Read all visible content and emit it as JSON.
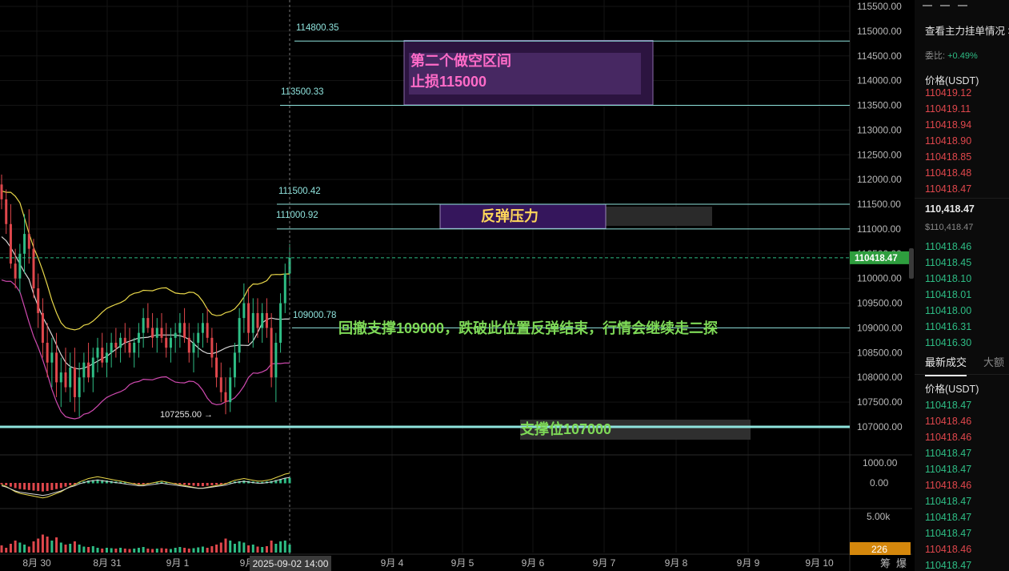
{
  "chart_data": {
    "type": "candlestick",
    "symbol_price_label": "110418.47",
    "current_price": 110418.47,
    "y_axis_ticks": [
      "115500.00",
      "115000.00",
      "114500.00",
      "114000.00",
      "113500.00",
      "113000.00",
      "112500.00",
      "112000.00",
      "111500.00",
      "111000.00",
      "110500.00",
      "110000.00",
      "109500.00",
      "109000.00",
      "108500.00",
      "108000.00",
      "107500.00",
      "107000.00"
    ],
    "y_axis_values": [
      115500,
      115000,
      114500,
      114000,
      113500,
      113000,
      112500,
      112000,
      111500,
      111000,
      110500,
      110000,
      109500,
      109000,
      108500,
      108000,
      107500,
      107000
    ],
    "ylim": [
      106700,
      115700
    ],
    "x_axis_ticks": [
      "8月 30",
      "8月 31",
      "9月 1",
      "9月",
      "9月 4",
      "9月 5",
      "9月 6",
      "9月 7",
      "9月 8",
      "9月 9",
      "9月 10"
    ],
    "crosshair_time": "2025-09-02 14:00",
    "price_lines": [
      {
        "label": "114800.35",
        "value": 114800.35
      },
      {
        "label": "113500.33",
        "value": 113500.33
      },
      {
        "label": "111500.42",
        "value": 111500.42
      },
      {
        "label": "111000.92",
        "value": 111000.92
      },
      {
        "label": "109000.78",
        "value": 109000.78
      },
      {
        "label": "",
        "value": 107000
      }
    ],
    "low_marker": {
      "label": "107255.00",
      "value": 107255
    },
    "zones": [
      {
        "name": "short_zone",
        "line1": "第二个做空区间",
        "line2": "止损115000",
        "top": 114780,
        "bottom": 113510,
        "color": "#5a2a78"
      },
      {
        "name": "rebound_pressure",
        "text": "反弹压力",
        "top": 111500,
        "bottom": 111010,
        "color": "#3a1760"
      },
      {
        "name": "support",
        "text": "支撑位107000",
        "top": 107140,
        "bottom": 106720,
        "color": "#333333"
      }
    ],
    "annotation": "回撤支撑109000，跌破此位置反弹结束，行情会继续走二探",
    "macd_axis_ticks": [
      "1000.00",
      "0.00"
    ],
    "volume_axis_ticks": [
      "5.00k"
    ],
    "volume_badge": "226",
    "bottom_right_labels": [
      "筹",
      "爆"
    ],
    "candles": [
      {
        "o": 111900,
        "h": 112100,
        "l": 111400,
        "c": 111600
      },
      {
        "o": 111600,
        "h": 111800,
        "l": 110900,
        "c": 111100
      },
      {
        "o": 111100,
        "h": 111500,
        "l": 110200,
        "c": 110300
      },
      {
        "o": 110300,
        "h": 110600,
        "l": 109800,
        "c": 110000
      },
      {
        "o": 110000,
        "h": 110700,
        "l": 109700,
        "c": 110500
      },
      {
        "o": 110500,
        "h": 111300,
        "l": 110100,
        "c": 110900
      },
      {
        "o": 110900,
        "h": 111400,
        "l": 110300,
        "c": 110600
      },
      {
        "o": 110600,
        "h": 110800,
        "l": 109600,
        "c": 109800
      },
      {
        "o": 109800,
        "h": 110100,
        "l": 109000,
        "c": 109300
      },
      {
        "o": 109300,
        "h": 109600,
        "l": 108400,
        "c": 108700
      },
      {
        "o": 108700,
        "h": 109100,
        "l": 108000,
        "c": 108300
      },
      {
        "o": 108300,
        "h": 108800,
        "l": 107800,
        "c": 108500
      },
      {
        "o": 108500,
        "h": 108900,
        "l": 107600,
        "c": 107900
      },
      {
        "o": 107900,
        "h": 108400,
        "l": 107400,
        "c": 108100
      },
      {
        "o": 108100,
        "h": 108600,
        "l": 107700,
        "c": 107800
      },
      {
        "o": 107800,
        "h": 108500,
        "l": 107500,
        "c": 108200
      },
      {
        "o": 108200,
        "h": 108600,
        "l": 107300,
        "c": 107600
      },
      {
        "o": 107600,
        "h": 108300,
        "l": 107200,
        "c": 108000
      },
      {
        "o": 108000,
        "h": 108500,
        "l": 107700,
        "c": 108300
      },
      {
        "o": 108300,
        "h": 108700,
        "l": 107900,
        "c": 108000
      },
      {
        "o": 108000,
        "h": 108600,
        "l": 107700,
        "c": 108400
      },
      {
        "o": 108400,
        "h": 108800,
        "l": 108100,
        "c": 108600
      },
      {
        "o": 108600,
        "h": 108900,
        "l": 108200,
        "c": 108300
      },
      {
        "o": 108300,
        "h": 108700,
        "l": 108000,
        "c": 108500
      },
      {
        "o": 108500,
        "h": 108900,
        "l": 108200,
        "c": 108700
      },
      {
        "o": 108700,
        "h": 109000,
        "l": 108400,
        "c": 108600
      },
      {
        "o": 108600,
        "h": 108900,
        "l": 108300,
        "c": 108800
      },
      {
        "o": 108800,
        "h": 109100,
        "l": 108500,
        "c": 108700
      },
      {
        "o": 108700,
        "h": 109000,
        "l": 108400,
        "c": 108500
      },
      {
        "o": 108500,
        "h": 108800,
        "l": 108200,
        "c": 108700
      },
      {
        "o": 108700,
        "h": 109100,
        "l": 108400,
        "c": 108900
      },
      {
        "o": 108900,
        "h": 109400,
        "l": 108600,
        "c": 109200
      },
      {
        "o": 109200,
        "h": 109500,
        "l": 108900,
        "c": 109000
      },
      {
        "o": 109000,
        "h": 109300,
        "l": 108600,
        "c": 108800
      },
      {
        "o": 108800,
        "h": 109200,
        "l": 108500,
        "c": 109000
      },
      {
        "o": 109000,
        "h": 109300,
        "l": 108700,
        "c": 108800
      },
      {
        "o": 108800,
        "h": 109100,
        "l": 108400,
        "c": 108600
      },
      {
        "o": 108600,
        "h": 109000,
        "l": 108300,
        "c": 108800
      },
      {
        "o": 108800,
        "h": 109100,
        "l": 108500,
        "c": 108900
      },
      {
        "o": 108900,
        "h": 109300,
        "l": 108600,
        "c": 109100
      },
      {
        "o": 109100,
        "h": 109400,
        "l": 108700,
        "c": 108800
      },
      {
        "o": 108800,
        "h": 109100,
        "l": 108300,
        "c": 108500
      },
      {
        "o": 108500,
        "h": 108900,
        "l": 108100,
        "c": 108700
      },
      {
        "o": 108700,
        "h": 109100,
        "l": 108400,
        "c": 108900
      },
      {
        "o": 108900,
        "h": 109300,
        "l": 108600,
        "c": 109100
      },
      {
        "o": 109100,
        "h": 109400,
        "l": 108700,
        "c": 108800
      },
      {
        "o": 108800,
        "h": 109000,
        "l": 108200,
        "c": 108400
      },
      {
        "o": 108400,
        "h": 108700,
        "l": 107800,
        "c": 108000
      },
      {
        "o": 108000,
        "h": 108300,
        "l": 107500,
        "c": 107700
      },
      {
        "o": 107700,
        "h": 108000,
        "l": 107255,
        "c": 107500
      },
      {
        "o": 107500,
        "h": 108200,
        "l": 107300,
        "c": 108000
      },
      {
        "o": 108000,
        "h": 108700,
        "l": 107800,
        "c": 108500
      },
      {
        "o": 108500,
        "h": 109400,
        "l": 108300,
        "c": 109200
      },
      {
        "o": 109200,
        "h": 109900,
        "l": 108900,
        "c": 109500
      },
      {
        "o": 109500,
        "h": 109800,
        "l": 108700,
        "c": 108900
      },
      {
        "o": 108900,
        "h": 109600,
        "l": 108600,
        "c": 109300
      },
      {
        "o": 109300,
        "h": 109600,
        "l": 108800,
        "c": 109000
      },
      {
        "o": 109000,
        "h": 109500,
        "l": 108700,
        "c": 109300
      },
      {
        "o": 109300,
        "h": 109600,
        "l": 108800,
        "c": 109000
      },
      {
        "o": 109000,
        "h": 109300,
        "l": 107800,
        "c": 108000
      },
      {
        "o": 108000,
        "h": 108900,
        "l": 107500,
        "c": 108700
      },
      {
        "o": 108700,
        "h": 109700,
        "l": 108500,
        "c": 109500
      },
      {
        "o": 109500,
        "h": 110300,
        "l": 109300,
        "c": 110100
      },
      {
        "o": 110100,
        "h": 110700,
        "l": 109900,
        "c": 110418
      }
    ],
    "volumes": [
      0.18,
      0.12,
      0.22,
      0.3,
      0.25,
      0.2,
      0.15,
      0.28,
      0.35,
      0.45,
      0.4,
      0.3,
      0.38,
      0.25,
      0.2,
      0.22,
      0.28,
      0.2,
      0.15,
      0.14,
      0.16,
      0.12,
      0.1,
      0.12,
      0.11,
      0.1,
      0.12,
      0.1,
      0.09,
      0.1,
      0.12,
      0.14,
      0.1,
      0.09,
      0.1,
      0.11,
      0.1,
      0.09,
      0.12,
      0.14,
      0.12,
      0.1,
      0.11,
      0.13,
      0.15,
      0.12,
      0.16,
      0.2,
      0.25,
      0.35,
      0.3,
      0.22,
      0.28,
      0.25,
      0.18,
      0.2,
      0.15,
      0.14,
      0.16,
      0.3,
      0.22,
      0.28,
      0.3,
      0.2
    ],
    "macd_hist": [
      -0.1,
      -0.2,
      -0.35,
      -0.5,
      -0.6,
      -0.65,
      -0.7,
      -0.75,
      -0.8,
      -0.85,
      -0.8,
      -0.7,
      -0.6,
      -0.5,
      -0.35,
      -0.2,
      -0.1,
      0.05,
      0.15,
      0.25,
      0.3,
      0.35,
      0.3,
      0.25,
      0.2,
      0.15,
      0.1,
      0.05,
      0.0,
      -0.05,
      -0.1,
      -0.1,
      -0.05,
      0.0,
      0.05,
      0.1,
      0.05,
      0.0,
      -0.05,
      -0.1,
      -0.15,
      -0.2,
      -0.25,
      -0.3,
      -0.3,
      -0.25,
      -0.2,
      -0.15,
      -0.1,
      -0.05,
      0.05,
      0.15,
      0.2,
      0.25,
      0.2,
      0.15,
      0.1,
      0.1,
      0.15,
      0.2,
      0.3,
      0.4,
      0.5,
      0.55
    ]
  },
  "order_book": {
    "title": "查看主力挂单情况",
    "ratio_label": "委比:",
    "ratio_value": "+0.49%",
    "price_header": "价格(USDT)",
    "asks": [
      "110419.12",
      "110419.11",
      "110418.94",
      "110418.90",
      "110418.85",
      "110418.48",
      "110418.47"
    ],
    "last_price": "110,418.47",
    "last_price_usd": "$110,418.47",
    "bids": [
      "110418.46",
      "110418.45",
      "110418.10",
      "110418.01",
      "110418.00",
      "110416.31",
      "110416.30"
    ]
  },
  "trades": {
    "tab_latest": "最新成交",
    "tab_large": "大额",
    "price_header": "价格(USDT)",
    "rows": [
      {
        "price": "110418.47",
        "side": "buy"
      },
      {
        "price": "110418.46",
        "side": "sell"
      },
      {
        "price": "110418.46",
        "side": "sell"
      },
      {
        "price": "110418.47",
        "side": "buy"
      },
      {
        "price": "110418.47",
        "side": "buy"
      },
      {
        "price": "110418.46",
        "side": "sell"
      },
      {
        "price": "110418.47",
        "side": "buy"
      },
      {
        "price": "110418.47",
        "side": "buy"
      },
      {
        "price": "110418.47",
        "side": "buy"
      },
      {
        "price": "110418.46",
        "side": "sell"
      },
      {
        "price": "110418.47",
        "side": "buy"
      }
    ]
  }
}
